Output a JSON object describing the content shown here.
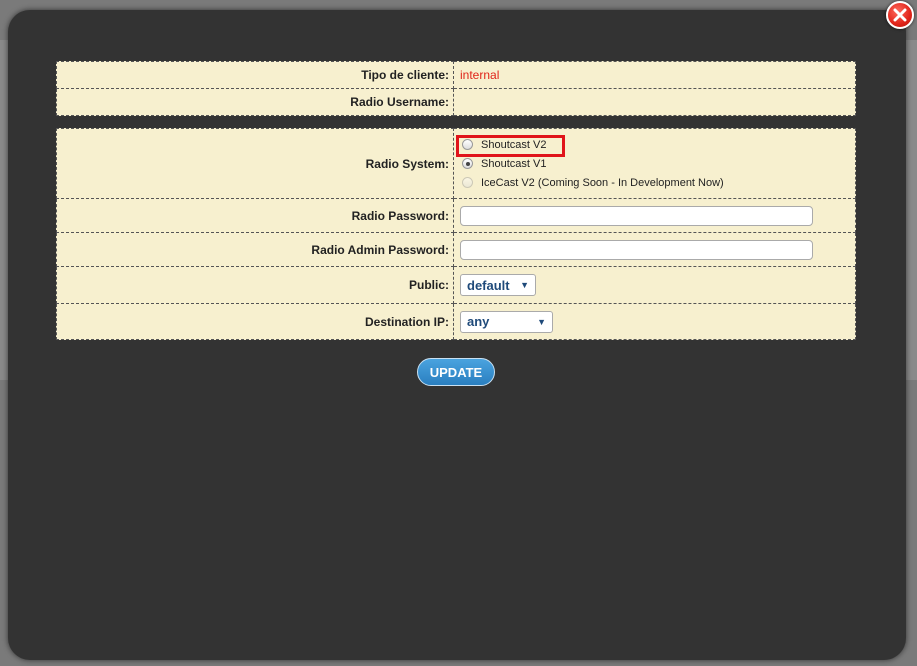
{
  "modal": {
    "close_icon": "close-icon"
  },
  "client_info": {
    "client_type_label": "Tipo de cliente:",
    "client_type_value": "internal",
    "username_label": "Radio Username:",
    "username_value": ""
  },
  "settings": {
    "radio_system_label": "Radio System:",
    "radio_options": [
      {
        "label": "Shoutcast V2",
        "checked": false,
        "disabled": false
      },
      {
        "label": "Shoutcast V1",
        "checked": true,
        "disabled": false
      },
      {
        "label": "IceCast V2 (Coming Soon - In Development Now)",
        "checked": false,
        "disabled": true
      }
    ],
    "password_label": "Radio Password:",
    "password_value": "",
    "admin_password_label": "Radio Admin Password:",
    "admin_password_value": "",
    "public_label": "Public:",
    "public_value": "default",
    "destination_label": "Destination IP:",
    "destination_value": "any"
  },
  "actions": {
    "update_label": "UPDATE"
  },
  "colors": {
    "modal_bg": "#333333",
    "form_bg": "#f7f0cf",
    "accent_red": "#e0241a",
    "button_blue": "#2a7fc0",
    "select_text": "#1f4a7a"
  }
}
